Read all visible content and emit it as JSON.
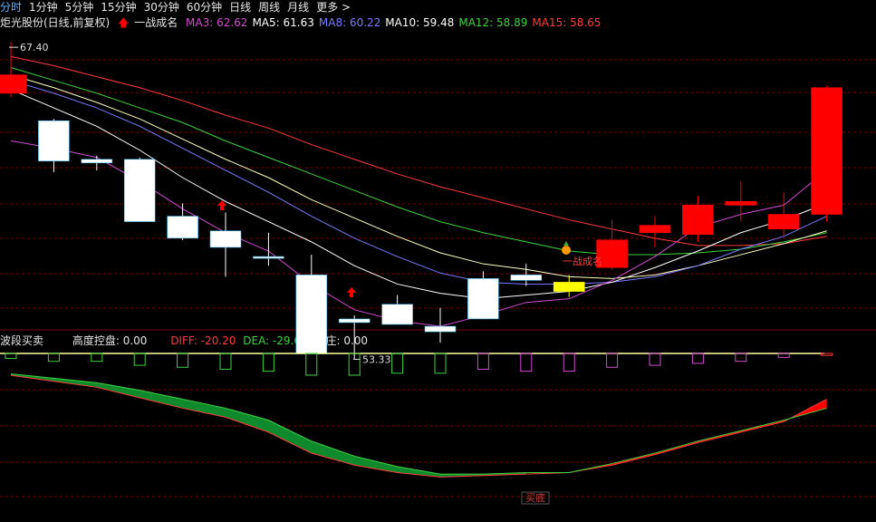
{
  "toolbar": {
    "items": [
      "分时",
      "1分钟",
      "5分钟",
      "15分钟",
      "30分钟",
      "60分钟",
      "日线",
      "周线",
      "月线",
      "更多 >"
    ],
    "active_index": 0
  },
  "main_legend": {
    "stock": "炬光股份(日线,前复权)",
    "signal_label": "一战成名",
    "ma": [
      {
        "label": "MA3: 62.62",
        "color": "#d24bd2"
      },
      {
        "label": "MA5: 61.63",
        "color": "#ffffff"
      },
      {
        "label": "MA8: 60.22",
        "color": "#7b7bff"
      },
      {
        "label": "MA10: 59.48",
        "color": "#ffffff"
      },
      {
        "label": "MA12: 58.89",
        "color": "#3fd23f"
      },
      {
        "label": "MA15: 58.65",
        "color": "#ff3b3b"
      }
    ]
  },
  "sub_legend": {
    "title": "波段买卖",
    "height_label": "高度控盘: 0.00",
    "diff_label": "DIFF: -20.20",
    "dea_label": "DEA: -29.60",
    "zhuang_label": "有庄: 0.00"
  },
  "annotations": {
    "high_label": "67.40",
    "low_label": "53.33",
    "signal_text": "一战成名",
    "buy_text": "买底"
  },
  "colors": {
    "up": "#ff0000",
    "down": "#ffffff",
    "yellow": "#ffff00",
    "grid": "#6e0000",
    "ma3": "#d24bd2",
    "ma5": "#ffffff",
    "ma8": "#7b7bff",
    "ma10": "#ffffc0",
    "ma12": "#3fd23f",
    "ma15": "#ff3b3b",
    "band_green": "#0e8a2c",
    "band_red": "#ff0000"
  },
  "chart_data": {
    "type": "candlestick",
    "ylim": [
      52,
      68
    ],
    "candles": [
      {
        "o": 64.6,
        "c": 65.6,
        "h": 67.4,
        "l": 64.4,
        "color": "up"
      },
      {
        "o": 63.1,
        "c": 60.9,
        "h": 63.2,
        "l": 60.3,
        "color": "down"
      },
      {
        "o": 61.0,
        "c": 60.8,
        "h": 61.2,
        "l": 60.4,
        "color": "down"
      },
      {
        "o": 61.0,
        "c": 57.6,
        "h": 61.1,
        "l": 57.6,
        "color": "down"
      },
      {
        "o": 57.9,
        "c": 56.7,
        "h": 58.6,
        "l": 56.6,
        "color": "down"
      },
      {
        "o": 57.1,
        "c": 56.2,
        "h": 58.1,
        "l": 54.6,
        "color": "down"
      },
      {
        "o": 55.7,
        "c": 55.6,
        "h": 57.0,
        "l": 55.2,
        "color": "down"
      },
      {
        "o": 54.7,
        "c": 50.4,
        "h": 55.8,
        "l": 50.4,
        "color": "down"
      },
      {
        "o": 52.3,
        "c": 52.1,
        "h": 52.5,
        "l": 50.1,
        "color": "down"
      },
      {
        "o": 53.1,
        "c": 52.0,
        "h": 53.6,
        "l": 52.0,
        "color": "down"
      },
      {
        "o": 51.9,
        "c": 51.6,
        "h": 52.9,
        "l": 51.0,
        "color": "down"
      },
      {
        "o": 54.5,
        "c": 52.3,
        "h": 54.9,
        "l": 52.3,
        "color": "down"
      },
      {
        "o": 54.7,
        "c": 54.4,
        "h": 55.3,
        "l": 54.1,
        "color": "down"
      },
      {
        "o": 54.3,
        "c": 53.8,
        "h": 54.7,
        "l": 53.5,
        "color": "yellow"
      },
      {
        "o": 55.1,
        "c": 56.6,
        "h": 57.7,
        "l": 55.0,
        "color": "up"
      },
      {
        "o": 57.0,
        "c": 57.4,
        "h": 57.9,
        "l": 56.2,
        "color": "up"
      },
      {
        "o": 56.9,
        "c": 58.5,
        "h": 59.0,
        "l": 56.5,
        "color": "up"
      },
      {
        "o": 58.5,
        "c": 58.7,
        "h": 59.8,
        "l": 57.6,
        "color": "up"
      },
      {
        "o": 57.2,
        "c": 58.0,
        "h": 59.2,
        "l": 56.8,
        "color": "up"
      },
      {
        "o": 58.0,
        "c": 64.9,
        "h": 65.0,
        "l": 57.6,
        "color": "up"
      }
    ],
    "ma3": [
      62.0,
      61.6,
      61.1,
      59.8,
      58.3,
      57.0,
      56.0,
      54.2,
      52.8,
      52.2,
      51.9,
      52.5,
      53.2,
      53.4,
      54.4,
      55.7,
      57.3,
      58.0,
      58.5,
      60.4
    ],
    "ma5": [
      64.8,
      63.8,
      62.8,
      61.5,
      60.0,
      58.7,
      57.6,
      56.5,
      55.2,
      54.2,
      53.7,
      53.4,
      53.6,
      53.8,
      54.3,
      55.1,
      56.0,
      57.0,
      57.7,
      58.6
    ],
    "ma8": [
      65.3,
      64.6,
      63.8,
      62.8,
      61.6,
      60.4,
      59.2,
      57.9,
      56.7,
      55.7,
      54.8,
      54.3,
      54.2,
      54.2,
      54.3,
      54.6,
      55.2,
      56.1,
      56.8,
      57.9
    ],
    "ma10": [
      65.6,
      64.9,
      64.1,
      63.2,
      62.1,
      61.0,
      60.0,
      58.8,
      57.8,
      56.8,
      55.9,
      55.3,
      55.0,
      54.6,
      54.5,
      54.7,
      55.2,
      55.8,
      56.4,
      57.1
    ],
    "ma12": [
      66.0,
      65.3,
      64.6,
      63.8,
      63.0,
      62.0,
      61.1,
      60.2,
      59.3,
      58.4,
      57.6,
      57.0,
      56.5,
      56.0,
      55.8,
      55.8,
      55.9,
      56.1,
      56.5,
      57.0
    ],
    "ma15": [
      66.6,
      66.1,
      65.5,
      64.9,
      64.2,
      63.4,
      62.7,
      61.8,
      61.0,
      60.2,
      59.5,
      58.9,
      58.3,
      57.7,
      57.2,
      56.7,
      56.3,
      56.3,
      56.4,
      56.8
    ],
    "sub_ylim": [
      -100,
      15
    ],
    "diff": [
      -2,
      -6,
      -10,
      -17,
      -24,
      -30,
      -40,
      -54,
      -62,
      -67,
      -70,
      -69,
      -68,
      -67,
      -62,
      -55,
      -47,
      -40,
      -33,
      -18
    ],
    "dea": [
      -1,
      -4,
      -7,
      -12,
      -18,
      -24,
      -32,
      -46,
      -56,
      -63,
      -68,
      -68,
      -67,
      -67,
      -61,
      -54,
      -46,
      -39,
      -32,
      -24
    ],
    "hist_color": [
      "green",
      "green",
      "green",
      "green",
      "green",
      "green",
      "green",
      "green",
      "green",
      "green",
      "green",
      "magenta",
      "magenta",
      "magenta",
      "magenta",
      "magenta",
      "magenta",
      "magenta",
      "magenta",
      "red"
    ],
    "hist": [
      -5,
      -8,
      -8,
      -12,
      -14,
      -16,
      -18,
      -22,
      -22,
      -20,
      -20,
      -16,
      -18,
      -18,
      -14,
      -12,
      -10,
      -8,
      -4,
      -2
    ]
  }
}
